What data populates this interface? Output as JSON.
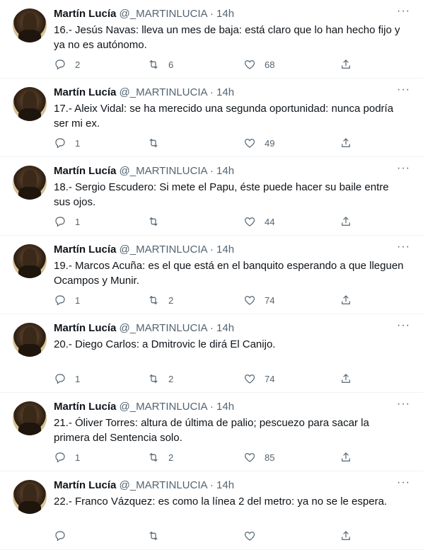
{
  "tweets": [
    {
      "name": "Martín Lucía",
      "handle": "@_MARTINLUCIA",
      "time": "14h",
      "text": "16.- Jesús Navas: lleva un mes de baja: está claro que lo han hecho fijo y ya no es autónomo.",
      "replies": "2",
      "retweets": "6",
      "likes": "68"
    },
    {
      "name": "Martín Lucía",
      "handle": "@_MARTINLUCIA",
      "time": "14h",
      "text": "17.- Aleix Vidal: se ha merecido una segunda oportunidad: nunca podría ser mi ex.",
      "replies": "1",
      "retweets": "",
      "likes": "49"
    },
    {
      "name": "Martín Lucía",
      "handle": "@_MARTINLUCIA",
      "time": "14h",
      "text": "18.- Sergio Escudero: Si mete el Papu, éste puede hacer su baile entre sus ojos.",
      "replies": "1",
      "retweets": "",
      "likes": "44"
    },
    {
      "name": "Martín Lucía",
      "handle": "@_MARTINLUCIA",
      "time": "14h",
      "text": "19.- Marcos Acuña: es el que está en el banquito esperando a que lleguen Ocampos y Munir.",
      "replies": "1",
      "retweets": "2",
      "likes": "74"
    },
    {
      "name": "Martín Lucía",
      "handle": "@_MARTINLUCIA",
      "time": "14h",
      "text": "20.- Diego Carlos: a Dmitrovic le dirá El Canijo.",
      "replies": "1",
      "retweets": "2",
      "likes": "74"
    },
    {
      "name": "Martín Lucía",
      "handle": "@_MARTINLUCIA",
      "time": "14h",
      "text": "21.- Óliver Torres: altura de última de palio; pescuezo para sacar la primera del Sentencia solo.",
      "replies": "1",
      "retweets": "2",
      "likes": "85"
    },
    {
      "name": "Martín Lucía",
      "handle": "@_MARTINLUCIA",
      "time": "14h",
      "text": "22.- Franco Vázquez: es como la línea 2 del metro: ya no se le espera.",
      "replies": "",
      "retweets": "",
      "likes": ""
    }
  ],
  "ui": {
    "separator": "·",
    "more": "···"
  },
  "icons": {
    "reply": "reply-icon",
    "retweet": "retweet-icon",
    "like": "heart-icon",
    "share": "share-icon",
    "more": "more-icon"
  }
}
